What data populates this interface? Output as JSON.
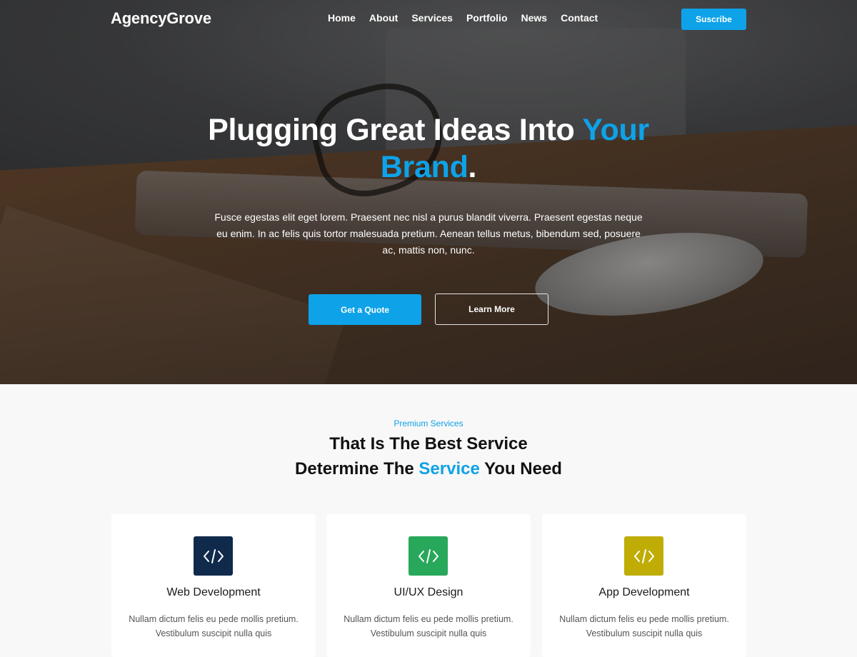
{
  "brand": {
    "name": "AgencyGrove",
    "accent": "#0ea2e8"
  },
  "nav": {
    "items": [
      {
        "label": "Home"
      },
      {
        "label": "About"
      },
      {
        "label": "Services"
      },
      {
        "label": "Portfolio"
      },
      {
        "label": "News"
      },
      {
        "label": "Contact"
      }
    ],
    "subscribe_label": "Suscribe"
  },
  "hero": {
    "title_part1": "Plugging Great Ideas Into ",
    "title_accent1": "Your",
    "title_accent2": "Brand",
    "title_end": ".",
    "text": "Fusce egestas elit eget lorem. Praesent nec nisl a purus blandit viverra. Praesent egestas neque eu enim. In ac felis quis tortor malesuada pretium. Aenean tellus metus, bibendum sed, posuere ac, mattis non, nunc.",
    "primary_button": "Get a Quote",
    "secondary_button": "Learn More"
  },
  "services": {
    "eyebrow": "Premium Services",
    "title_line1": "That Is The Best Service",
    "title_line2_pre": "Determine The ",
    "title_line2_accent": "Service",
    "title_line2_post": " You Need",
    "cards": [
      {
        "icon": "code-icon",
        "icon_color": "#0f2a4a",
        "title": "Web Development",
        "desc": "Nullam dictum felis eu pede mollis pretium. Vestibulum suscipit nulla quis"
      },
      {
        "icon": "code-icon",
        "icon_color": "#27a85a",
        "title": "UI/UX Design",
        "desc": "Nullam dictum felis eu pede mollis pretium. Vestibulum suscipit nulla quis"
      },
      {
        "icon": "code-icon",
        "icon_color": "#bfad06",
        "title": "App Development",
        "desc": "Nullam dictum felis eu pede mollis pretium. Vestibulum suscipit nulla quis"
      }
    ]
  }
}
